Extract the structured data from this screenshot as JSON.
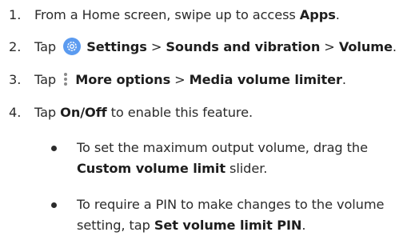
{
  "steps": [
    {
      "number": "1.",
      "pre": "From a Home screen, swipe up to access ",
      "bold": "Apps",
      "post": "."
    },
    {
      "number": "2.",
      "pre": "Tap ",
      "icon": "settings-gear-icon",
      "bold1": "Settings",
      "sep1": " > ",
      "bold2": "Sounds and vibration",
      "sep2": " > ",
      "bold3": "Volume",
      "post": "."
    },
    {
      "number": "3.",
      "pre": "Tap ",
      "icon": "more-options-icon",
      "bold1": "More options",
      "sep1": " > ",
      "bold2": "Media volume limiter",
      "post": "."
    },
    {
      "number": "4.",
      "pre": "Tap ",
      "bold": "On/Off",
      "post": " to enable this feature."
    }
  ],
  "bullets": [
    {
      "line1": "To set the maximum output volume, drag the",
      "bold": "Custom volume limit",
      "post": " slider."
    },
    {
      "line1": "To require a PIN to make changes to the volume",
      "pre2": "setting, tap ",
      "bold": "Set volume limit PIN",
      "post": "."
    }
  ],
  "colors": {
    "text": "#2b2b2b",
    "settings_icon_bg": "#5b9bf0",
    "more_icon_dots": "#8a8a8a"
  }
}
